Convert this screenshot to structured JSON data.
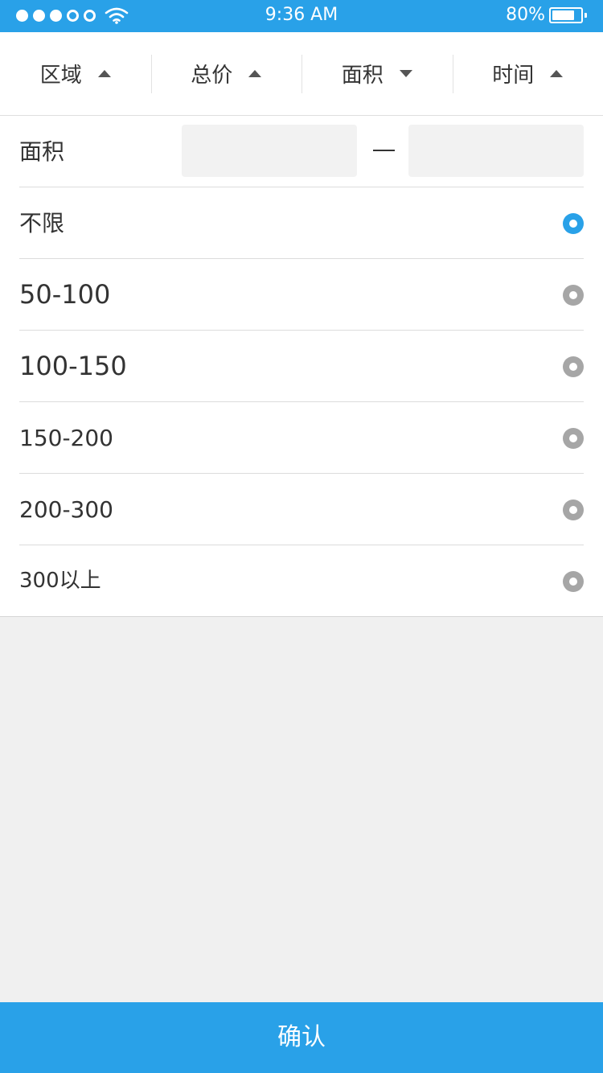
{
  "status_bar": {
    "time": "9:36 AM",
    "battery": "80%",
    "battery_level": 0.8,
    "signal": [
      "full",
      "full",
      "full",
      "empty",
      "empty"
    ]
  },
  "filters": [
    {
      "label": "区域",
      "arrow": "up"
    },
    {
      "label": "总价",
      "arrow": "up"
    },
    {
      "label": "面积",
      "arrow": "down"
    },
    {
      "label": "时间",
      "arrow": "up"
    }
  ],
  "range": {
    "label": "面积",
    "min_value": "",
    "max_value": "",
    "separator": "—"
  },
  "options": [
    {
      "label": "不限",
      "selected": true
    },
    {
      "label": "50-100",
      "selected": false
    },
    {
      "label": "100-150",
      "selected": false
    },
    {
      "label": "150-200",
      "selected": false
    },
    {
      "label": "200-300",
      "selected": false
    },
    {
      "label": "300以上",
      "selected": false
    }
  ],
  "confirm_label": "确认",
  "colors": {
    "accent": "#29a1e8",
    "radio_inactive": "#a6a6a6",
    "background": "#f0f0f0"
  }
}
